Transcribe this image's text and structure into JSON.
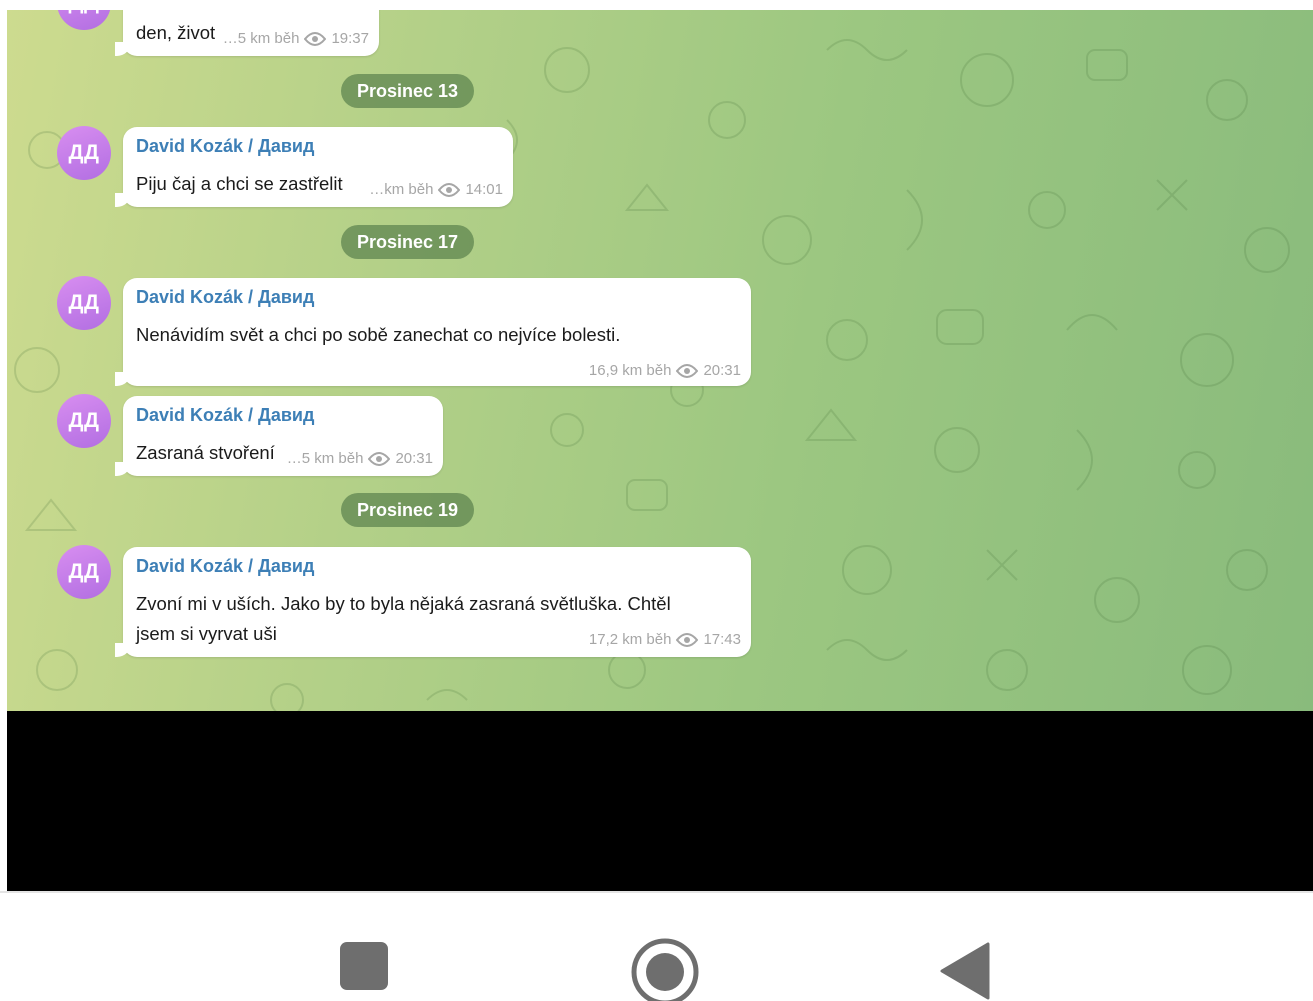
{
  "messages": [
    {
      "sender": "",
      "text": "den, život",
      "distance": "…5 km běh",
      "time": "19:37",
      "avatar_initials": ""
    },
    {
      "sender": "David Kozák / Давид",
      "text": "Piju čaj a chci se zastřelit",
      "distance": "…km běh",
      "time": "14:01",
      "avatar_initials": "ДД"
    },
    {
      "sender": "David Kozák / Давид",
      "text": "Nenávidím svět a chci po sobě zanechat co nejvíce bolesti.",
      "distance": "16,9 km běh",
      "time": "20:31",
      "avatar_initials": "ДД"
    },
    {
      "sender": "David Kozák / Давид",
      "text": "Zasraná stvoření",
      "distance": "…5 km běh",
      "time": "20:31",
      "avatar_initials": "ДД"
    },
    {
      "sender": "David Kozák / Давид",
      "text_line1": "Zvoní mi v uších. Jako by to byla nějaká zasraná světluška. Chtěl",
      "text_line2": "jsem si vyrvat uši",
      "distance": "17,2 km běh",
      "time": "17:43",
      "avatar_initials": "ДД"
    }
  ],
  "date_separators": {
    "d1": "Prosinec 13",
    "d2": "Prosinec 17",
    "d3": "Prosinec 19"
  },
  "icons": {
    "views": "eye-icon",
    "nav_recents": "square-icon",
    "nav_home": "circle-icon",
    "nav_back": "triangle-back-icon"
  },
  "colors": {
    "sender_name": "#3d7fb6",
    "avatar": "#c27ee8",
    "date_pill": "#5c824e",
    "meta_text": "#a6a6a6"
  }
}
